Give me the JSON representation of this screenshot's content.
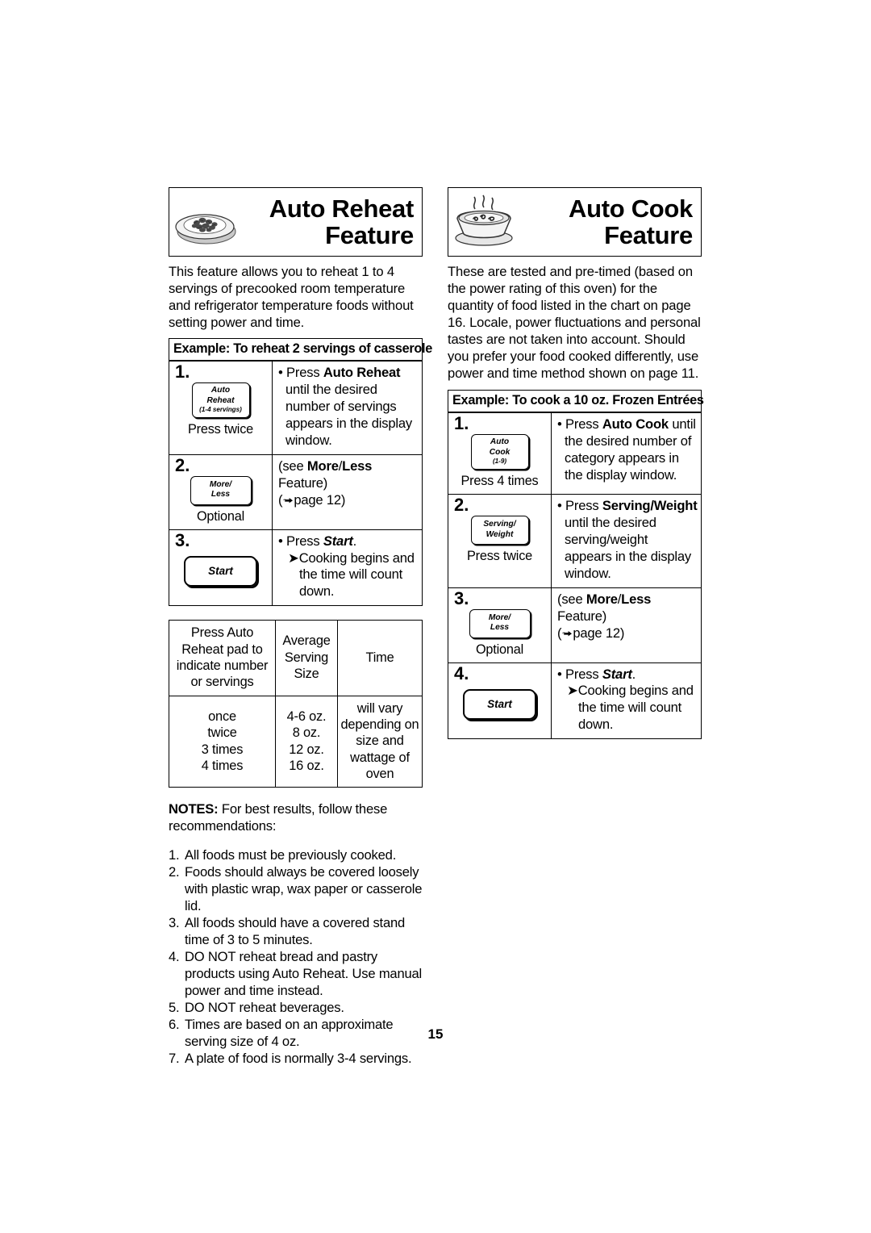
{
  "page": {
    "number": "15"
  },
  "left": {
    "banner": {
      "icon": "plate-of-food-icon",
      "title_line1": "Auto Reheat",
      "title_line2": "Feature"
    },
    "intro": "This feature allows you to reheat 1 to 4 servings of precooked room temperature and refrigerator temperature foods without setting power and time.",
    "example_heading": "Example: To reheat  2 servings of casserole",
    "steps": [
      {
        "number": "1.",
        "pad_line1": "Auto",
        "pad_line2": "Reheat",
        "pad_line3": "(1-4 servings)",
        "caption": "Press twice",
        "body_lead_bullet": "• Press ",
        "body_bold": "Auto Reheat",
        "body_rest": " until the desired number of servings appears in the display window."
      },
      {
        "number": "2.",
        "pad_line1": "More/",
        "pad_line2": "Less",
        "caption": "Optional",
        "body_pre": "(see ",
        "body_bold_a": "More",
        "body_slash": "/",
        "body_bold_b": "Less",
        "body_post": " Feature)",
        "body_page": "page 12)"
      },
      {
        "number": "3.",
        "pad_start": "Start",
        "body_bullet": "• Press ",
        "body_italic": "Start",
        "body_period": ".",
        "body_arrow": "Cooking begins and the time will count down."
      }
    ],
    "size_table": {
      "headers": [
        "Press Auto Reheat pad to indicate number or servings",
        "Average Serving Size",
        "Time"
      ],
      "col1": [
        "once",
        "twice",
        "3 times",
        "4 times"
      ],
      "col2": [
        "4-6 oz.",
        "8 oz.",
        "12 oz.",
        "16 oz."
      ],
      "col3": [
        "will vary",
        "depending on",
        "size and",
        "wattage of oven"
      ]
    },
    "notes": {
      "head_bold": "NOTES:",
      "head_rest": " For best results, follow these recommendations:",
      "items": [
        {
          "n": "1.",
          "t": "All foods must be previously cooked."
        },
        {
          "n": "2.",
          "t": "Foods should always be covered loosely with plastic wrap, wax paper or casserole lid."
        },
        {
          "n": "3.",
          "t": "All foods should have a covered stand time of 3 to 5 minutes."
        },
        {
          "n": "4.",
          "t": "DO NOT reheat bread and pastry products using Auto Reheat. Use manual power and time instead."
        },
        {
          "n": "5.",
          "t": "DO NOT reheat beverages."
        },
        {
          "n": "6.",
          "t": "Times are based on an approximate serving size of 4 oz."
        },
        {
          "n": "7.",
          "t": "A plate of food is normally 3-4 servings."
        }
      ]
    }
  },
  "right": {
    "banner": {
      "icon": "steaming-bowl-icon",
      "title_line1": "Auto Cook",
      "title_line2": "Feature"
    },
    "intro": "These are tested and pre-timed (based on the power rating of this oven) for the quantity of food listed in the chart on page 16. Locale, power fluctuations and personal tastes are not taken into account. Should you prefer your food cooked differently, use power and time method shown on page 11.",
    "example_heading": "Example: To cook a 10 oz. Frozen Entrées",
    "steps": [
      {
        "number": "1.",
        "pad_line1": "Auto",
        "pad_line2": "Cook",
        "pad_line3": "(1-9)",
        "caption": "Press 4 times",
        "body_lead_bullet": "• Press ",
        "body_bold": "Auto Cook",
        "body_rest": " until the desired number of category appears in the display window."
      },
      {
        "number": "2.",
        "pad_line1": "Serving/",
        "pad_line2": "Weight",
        "caption": "Press twice",
        "body_lead_bullet": "• Press ",
        "body_bold": "Serving/Weight",
        "body_rest": " until the desired serving/weight appears in the display window."
      },
      {
        "number": "3.",
        "pad_line1": "More/",
        "pad_line2": "Less",
        "caption": "Optional",
        "body_pre": "(see ",
        "body_bold_a": "More",
        "body_slash": "/",
        "body_bold_b": "Less",
        "body_post": " Feature)",
        "body_page": "page 12)"
      },
      {
        "number": "4.",
        "pad_start": "Start",
        "body_bullet": "• Press ",
        "body_italic": "Start",
        "body_period": ".",
        "body_arrow": "Cooking begins and the time will count down."
      }
    ]
  }
}
